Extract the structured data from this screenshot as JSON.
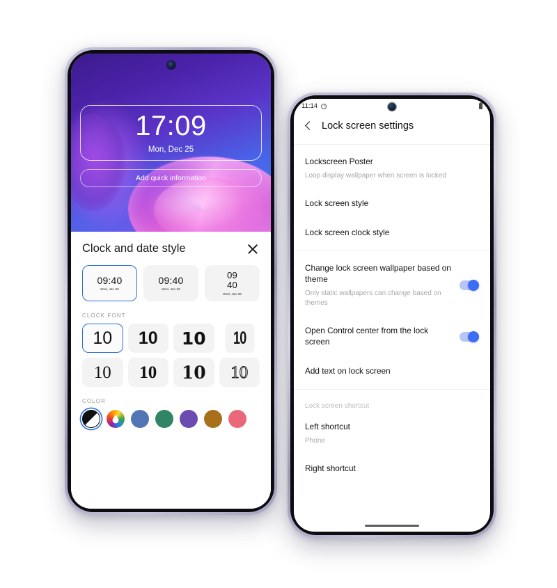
{
  "left_phone": {
    "lockscreen": {
      "time": "17:09",
      "date": "Mon, Dec 25",
      "quick_info_label": "Add quick information"
    },
    "sheet": {
      "title": "Clock and date style",
      "close_icon": "close-icon",
      "clock_styles": [
        {
          "time": "09:40",
          "date": "Wed, Jan 06",
          "layout": "inline",
          "selected": true
        },
        {
          "time": "09:40",
          "date": "Wed, Jan 06",
          "layout": "inline",
          "selected": false
        },
        {
          "time": "09\n40",
          "time_top": "09",
          "time_bottom": "40",
          "date": "Wed, Jan 06",
          "layout": "stacked",
          "selected": false
        }
      ],
      "font_section_label": "CLOCK FONT",
      "font_tiles": [
        {
          "sample": "10",
          "style": "sans-regular",
          "selected": true
        },
        {
          "sample": "10",
          "style": "sans-bold",
          "selected": false
        },
        {
          "sample": "10",
          "style": "dejavu-bold",
          "selected": false
        },
        {
          "sample": "10",
          "style": "condensed-bold",
          "selected": false
        },
        {
          "sample": "10",
          "style": "serif-regular",
          "selected": false
        },
        {
          "sample": "10",
          "style": "serif-bold",
          "selected": false
        },
        {
          "sample": "10",
          "style": "slab-bold",
          "selected": false
        },
        {
          "sample": "10",
          "style": "outline",
          "selected": false
        }
      ],
      "color_section_label": "COLOR",
      "colors": [
        {
          "name": "black-white-split",
          "hex": "#111111",
          "selected": true
        },
        {
          "name": "rainbow-picker",
          "hex": "#multi",
          "selected": false
        },
        {
          "name": "blue",
          "hex": "#5276b5",
          "selected": false
        },
        {
          "name": "green",
          "hex": "#2f8565",
          "selected": false
        },
        {
          "name": "purple",
          "hex": "#6b4bb0",
          "selected": false
        },
        {
          "name": "ochre",
          "hex": "#a8701a",
          "selected": false
        },
        {
          "name": "coral",
          "hex": "#ea6878",
          "selected": false
        }
      ]
    }
  },
  "right_phone": {
    "status_bar": {
      "time": "11:14",
      "alarm_icon": "alarm-icon",
      "battery_icon": "battery-icon"
    },
    "header": {
      "back_icon": "back-chevron-icon",
      "title": "Lock screen settings"
    },
    "settings": [
      {
        "title": "Lockscreen Poster",
        "subtitle": "Loop display wallpaper when screen is locked",
        "toggle": null
      },
      {
        "title": "Lock screen style",
        "subtitle": null,
        "toggle": null
      },
      {
        "title": "Lock screen clock style",
        "subtitle": null,
        "toggle": null
      },
      {
        "title": "Change lock screen wallpaper based on theme",
        "subtitle": "Only static wallpapers can change based on themes",
        "toggle": "on"
      },
      {
        "title": "Open Control center from the lock screen",
        "subtitle": null,
        "toggle": "on"
      },
      {
        "title": "Add text on lock screen",
        "subtitle": null,
        "toggle": null
      }
    ],
    "shortcut_group_label": "Lock screen shortcut",
    "shortcuts": [
      {
        "title": "Left shortcut",
        "subtitle": "Phone"
      },
      {
        "title": "Right shortcut",
        "subtitle": null
      }
    ]
  },
  "theme": {
    "accent_blue": "#3b6ef5",
    "selection_blue": "#2a6fe0",
    "tile_grey": "#f3f3f3",
    "subtitle_grey": "#a8a8a8"
  }
}
